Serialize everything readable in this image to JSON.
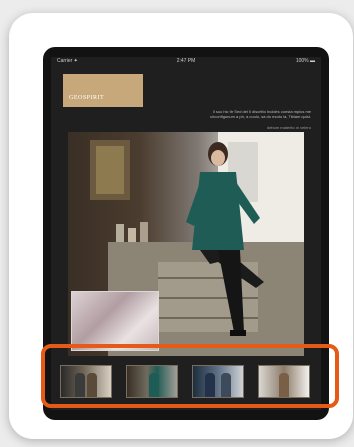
{
  "status_bar": {
    "carrier": "Carrier ✦",
    "time": "2:47 PM",
    "battery": "100% ▬"
  },
  "brand": {
    "logo_text": "GEOSPIRIT"
  },
  "intro": {
    "text": "Il suo hic ttr Sed del Il discritto Incides consta mpius me circonfigunum a ph, a coulu, sa do modo la, Tibiam quist.",
    "link": "debum materito ni velero"
  },
  "thumbnails": [
    {
      "name": "thumb-1"
    },
    {
      "name": "thumb-2"
    },
    {
      "name": "thumb-3"
    },
    {
      "name": "thumb-4"
    }
  ],
  "colors": {
    "highlight": "#e55a17",
    "logo_bg": "#c7a87b",
    "coat": "#1f5c55"
  }
}
